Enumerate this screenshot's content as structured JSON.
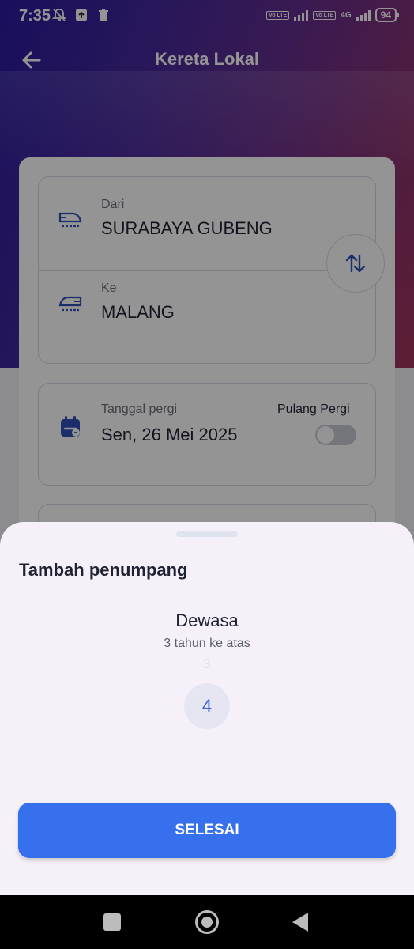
{
  "status_bar": {
    "time": "7:35",
    "battery": "94",
    "network": "4G",
    "volte": "Vo LTE"
  },
  "header": {
    "title": "Kereta Lokal"
  },
  "route": {
    "from_label": "Dari",
    "from_value": "SURABAYA GUBENG",
    "to_label": "Ke",
    "to_value": "MALANG"
  },
  "date": {
    "label": "Tanggal pergi",
    "value": "Sen, 26 Mei 2025",
    "round_trip_label": "Pulang Pergi",
    "round_trip_enabled": false
  },
  "sheet": {
    "title": "Tambah penumpang",
    "category_name": "Dewasa",
    "category_desc": "3 tahun ke atas",
    "picker_prev": "3",
    "picker_selected": "4",
    "done_label": "SELESAI"
  },
  "colors": {
    "accent": "#3770ec",
    "icon_blue": "#2f4fb8",
    "sheet_bg": "#f6f1f8"
  }
}
